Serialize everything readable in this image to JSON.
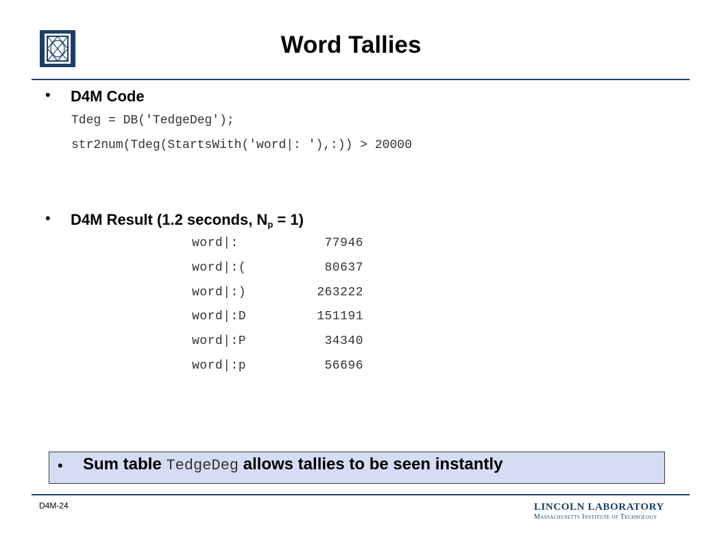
{
  "slide": {
    "title": "Word Tallies",
    "section1": {
      "bullet": "•",
      "heading": "D4M Code",
      "code_lines": [
        "Tdeg = DB('TedgeDeg');",
        "str2num(Tdeg(StartsWith('word|: '),:)) > 20000"
      ]
    },
    "section2": {
      "bullet": "•",
      "heading_prefix": "D4M Result (1.2 seconds, N",
      "heading_sub": "p",
      "heading_suffix": " = 1)",
      "rows": [
        {
          "key": "word|:",
          "value": "77946"
        },
        {
          "key": "word|:(",
          "value": "80637"
        },
        {
          "key": "word|:)",
          "value": "263222"
        },
        {
          "key": "word|:D",
          "value": "151191"
        },
        {
          "key": "word|:P",
          "value": "34340"
        },
        {
          "key": "word|:p",
          "value": "56696"
        }
      ]
    },
    "callout": {
      "bullet": "•",
      "text_before": "Sum table ",
      "code": "TedgeDeg",
      "text_after": " allows tallies to be seen instantly"
    }
  },
  "footer": {
    "slide_id": "D4M-24",
    "lab_name": "LINCOLN LABORATORY",
    "institute": "Massachusetts Institute of Technology"
  },
  "colors": {
    "accent": "#1c3f66",
    "callout_bg": "#d6dcf2"
  },
  "icons": {
    "logo": "mit-ll-logo-icon"
  }
}
